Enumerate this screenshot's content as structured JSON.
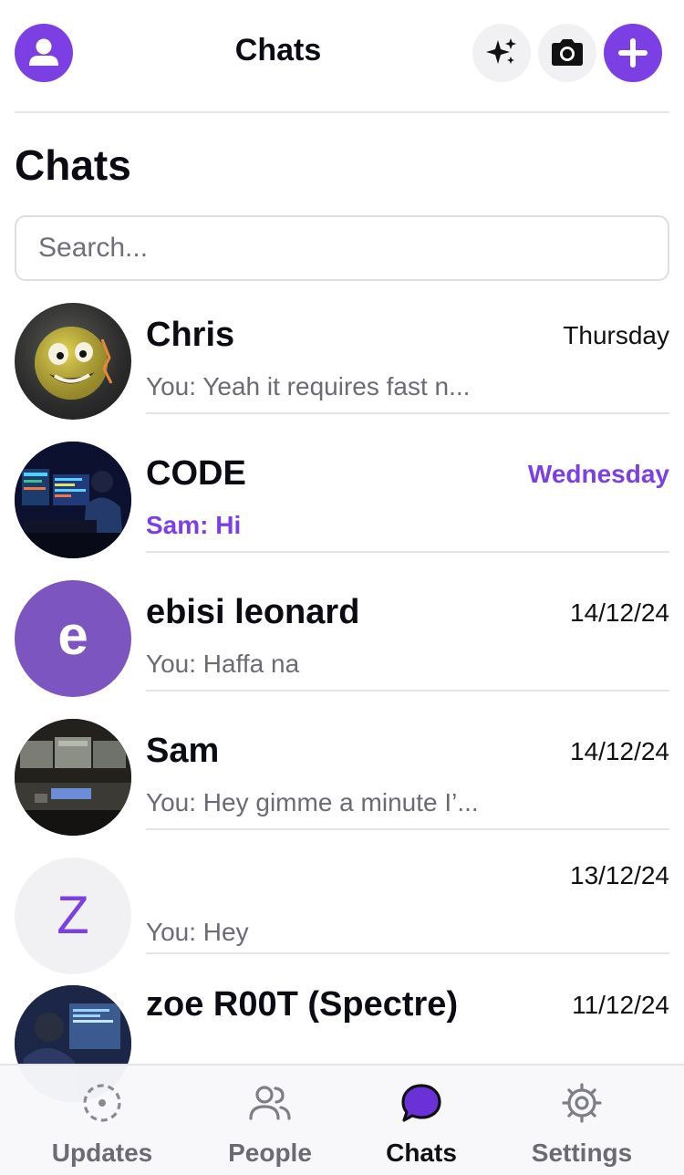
{
  "header": {
    "title": "Chats"
  },
  "page_title": "Chats",
  "search": {
    "placeholder": "Search...",
    "value": ""
  },
  "chats": [
    {
      "name": "Chris",
      "time": "Thursday",
      "preview": "You: Yeah it requires fast n...",
      "unread": false,
      "avatar": "image"
    },
    {
      "name": "CODE",
      "time": "Wednesday",
      "preview": "Sam: Hi",
      "unread": true,
      "avatar": "image"
    },
    {
      "name": "ebisi leonard",
      "time": "14/12/24",
      "preview": "You: Haffa na",
      "unread": false,
      "avatar": "letter",
      "avatar_letter": "e"
    },
    {
      "name": "Sam",
      "time": "14/12/24",
      "preview": "You: Hey gimme a minute I’...",
      "unread": false,
      "avatar": "image"
    },
    {
      "name": "",
      "time": "13/12/24",
      "preview": "You: Hey",
      "unread": false,
      "avatar": "letter",
      "avatar_letter": "Z"
    },
    {
      "name": "zoe R00T (Spectre)",
      "time": "11/12/24",
      "preview": "",
      "unread": false,
      "avatar": "image"
    }
  ],
  "bottom_nav": [
    {
      "label": "Updates",
      "icon": "updates-icon",
      "active": false
    },
    {
      "label": "People",
      "icon": "people-icon",
      "active": false
    },
    {
      "label": "Chats",
      "icon": "chat-bubble-icon",
      "active": true
    },
    {
      "label": "Settings",
      "icon": "gear-icon",
      "active": false
    }
  ],
  "colors": {
    "accent": "#7b3fe4",
    "text": "#0b0b14",
    "muted": "#6b6b74"
  }
}
